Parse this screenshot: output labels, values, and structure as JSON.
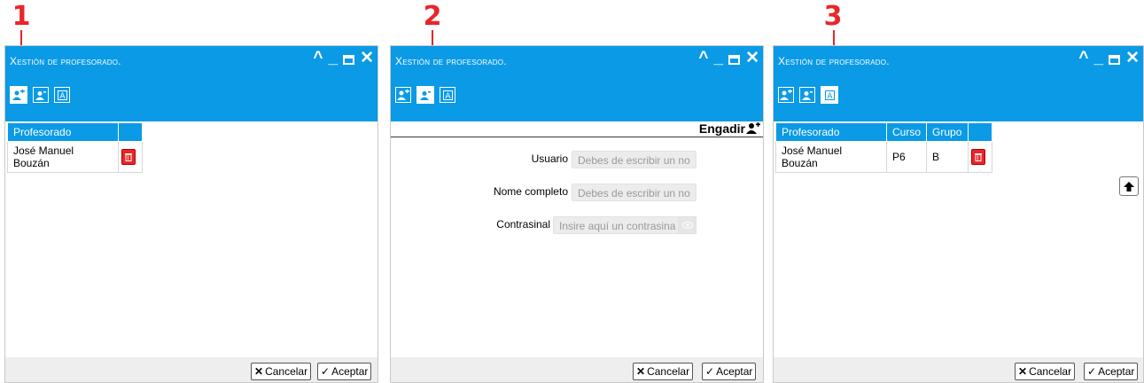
{
  "markers": [
    "1",
    "2",
    "3"
  ],
  "colors": {
    "header": "#0a9ae6",
    "marker": "#e8262a",
    "delete": "#e8262a"
  },
  "window_title": "Xestión de profesorado.",
  "window_controls": [
    "collapse-icon",
    "minimize-icon",
    "maximize-icon",
    "close-icon"
  ],
  "toolbar": [
    "list-teachers-icon",
    "add-teacher-icon",
    "assign-group-icon"
  ],
  "panel1": {
    "columns": [
      "Profesorado"
    ],
    "rows": [
      {
        "name": "José Manuel Bouzán"
      }
    ]
  },
  "panel2": {
    "form_title": "Engadir",
    "fields": [
      {
        "label": "Usuario",
        "placeholder": "Debes de escribir un no"
      },
      {
        "label": "Nome completo",
        "placeholder": "Debes de escribir un no"
      },
      {
        "label": "Contrasinal",
        "placeholder": "Insire aquí un contrasina"
      }
    ]
  },
  "panel3": {
    "columns": [
      "Profesorado",
      "Curso",
      "Grupo"
    ],
    "rows": [
      {
        "name": "José Manuel Bouzán",
        "curso": "P6",
        "grupo": "B"
      }
    ]
  },
  "footer": {
    "cancel_label": "Cancelar",
    "accept_label": "Aceptar"
  }
}
